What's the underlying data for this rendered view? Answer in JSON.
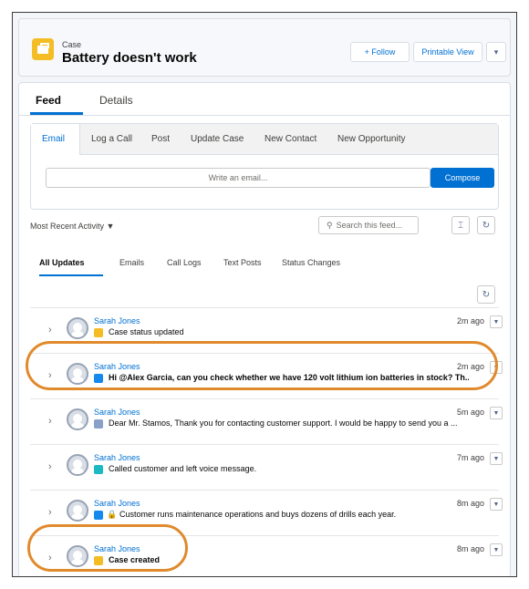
{
  "header": {
    "object_label": "Case",
    "title": "Battery doesn't work",
    "follow_label": "+ Follow",
    "printable_label": "Printable View",
    "menu_glyph": "▾"
  },
  "main_tabs": [
    {
      "label": "Feed",
      "active": true
    },
    {
      "label": "Details",
      "active": false
    }
  ],
  "publisher": {
    "tabs": [
      "Email",
      "Log a Call",
      "Post",
      "Update Case",
      "New Contact",
      "New Opportunity"
    ],
    "active_tab": "Email",
    "email_placeholder": "Write an email...",
    "compose_label": "Compose"
  },
  "feed_controls": {
    "sort_label": "Most Recent Activity ▼",
    "search_placeholder": "Search this feed...",
    "collapse_glyph": "⌶",
    "refresh_glyph": "↻"
  },
  "filter_tabs": [
    "All Updates",
    "Emails",
    "Call Logs",
    "Text Posts",
    "Status Changes"
  ],
  "feed_items": [
    {
      "author": "Sarah Jones",
      "message": "Case status updated",
      "time": "2m ago",
      "icon": "case-icon",
      "color": "#f4bc25",
      "bold": false,
      "lock": false,
      "highlighted": false
    },
    {
      "author": "Sarah Jones",
      "message": "Hi @Alex Garcia, can you check whether we have 120 volt lithium ion batteries in stock? Th...",
      "time": "2m ago",
      "icon": "post-icon",
      "color": "#1589ee",
      "bold": true,
      "lock": false,
      "highlighted": true
    },
    {
      "author": "Sarah Jones",
      "message": "Dear Mr. Stamos, Thank you for contacting customer support. I would be happy to send you a ...",
      "time": "5m ago",
      "icon": "email-icon",
      "color": "#8aa0c7",
      "bold": false,
      "lock": false,
      "highlighted": false
    },
    {
      "author": "Sarah Jones",
      "message": "Called customer and left voice message.",
      "time": "7m ago",
      "icon": "call-log-icon",
      "color": "#1ab9c4",
      "bold": false,
      "lock": false,
      "highlighted": false
    },
    {
      "author": "Sarah Jones",
      "message": "Customer runs maintenance operations and buys dozens of drills each year.",
      "time": "8m ago",
      "icon": "note-icon",
      "color": "#1589ee",
      "bold": false,
      "lock": true,
      "highlighted": false
    },
    {
      "author": "Sarah Jones",
      "message": "Case created",
      "time": "8m ago",
      "icon": "case-icon",
      "color": "#f4bc25",
      "bold": true,
      "lock": false,
      "highlighted": true
    }
  ],
  "colors": {
    "accent": "#0070d2",
    "highlight": "#e08a2c"
  }
}
